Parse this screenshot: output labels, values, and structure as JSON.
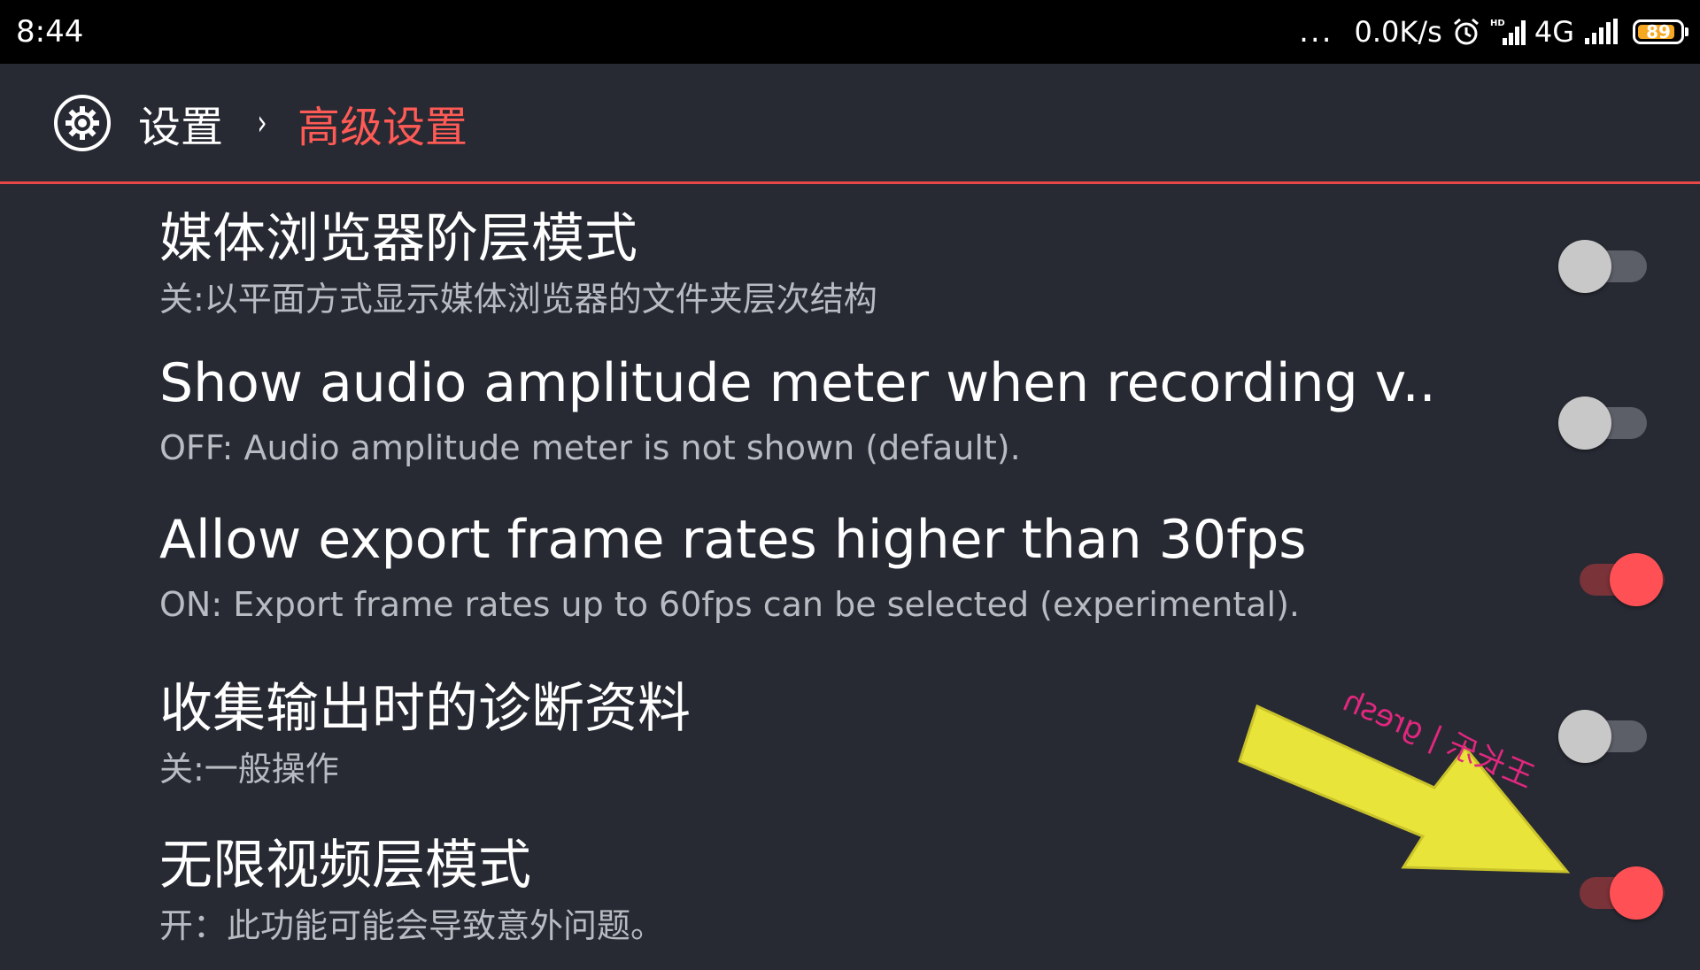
{
  "status_bar": {
    "time": "8:44",
    "dots": "...",
    "speed": "0.0K/s",
    "alarm_icon": "alarm-icon",
    "hd_signal_icon": "hd-signal-icon",
    "network": "4G",
    "signal_icon": "signal-bars-icon",
    "battery_level": "89",
    "battery_fraction": 0.89,
    "battery_color": "#f6a821"
  },
  "toolbar": {
    "icon": "settings-icon",
    "parent": "设置",
    "separator": "›",
    "current": "高级设置"
  },
  "preferences": [
    {
      "title": "媒体浏览器阶层模式",
      "summary": "关:以平面方式显示媒体浏览器的文件夹层次结构",
      "state": "off"
    },
    {
      "title": "Show audio amplitude meter when recording v..",
      "summary": "OFF: Audio amplitude meter is not shown (default).",
      "state": "off"
    },
    {
      "title": "Allow export frame rates higher than 30fps",
      "summary": "ON: Export frame rates up to 60fps can be selected (experimental).",
      "state": "on"
    },
    {
      "title": "收集输出时的诊断资料",
      "summary": "关:一般操作",
      "state": "off"
    },
    {
      "title": "无限视频层模式",
      "summary": "开：此功能可能会导致意外问题。",
      "state": "on"
    }
  ],
  "watermark": {
    "text": "王长乐 | gresh",
    "icon": "watermark-arrow-icon"
  },
  "colors": {
    "background": "#272a33",
    "accent": "#ff5a55",
    "divider": "#e84848",
    "toggle_on": "#ff5155",
    "toggle_off": "#c8c8c8"
  }
}
